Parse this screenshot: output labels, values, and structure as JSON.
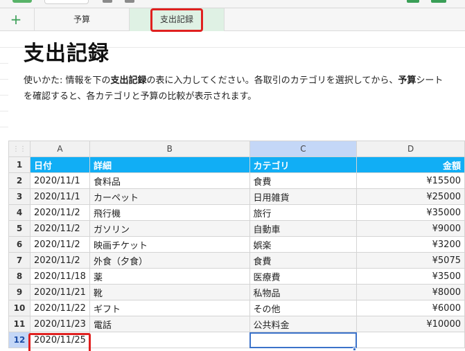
{
  "tabs": [
    {
      "label": "予算"
    },
    {
      "label": "支出記録"
    }
  ],
  "add_tab_label": "+",
  "title": "支出記録",
  "description": {
    "part1": "使いかた: 情報を下の",
    "bold1": "支出記録",
    "part2": "の表に入力してください。各取引のカテゴリを選択してから、",
    "bold2": "予算",
    "part3": "シートを確認すると、各カテゴリと予算の比較が表示されます。"
  },
  "columns": [
    "A",
    "B",
    "C",
    "D"
  ],
  "corner_glyph": "⋮⋮",
  "header_row": {
    "num": "1",
    "cells": [
      "日付",
      "詳細",
      "カテゴリ",
      "金額"
    ]
  },
  "rows": [
    {
      "num": "2",
      "date": "2020/11/1",
      "detail": "食料品",
      "category": "食費",
      "amount": "¥15500"
    },
    {
      "num": "3",
      "date": "2020/11/1",
      "detail": "カーペット",
      "category": "日用雑貨",
      "amount": "¥25000"
    },
    {
      "num": "4",
      "date": "2020/11/2",
      "detail": "飛行機",
      "category": "旅行",
      "amount": "¥35000"
    },
    {
      "num": "5",
      "date": "2020/11/2",
      "detail": "ガソリン",
      "category": "自動車",
      "amount": "¥9000"
    },
    {
      "num": "6",
      "date": "2020/11/2",
      "detail": "映画チケット",
      "category": "娯楽",
      "amount": "¥3200"
    },
    {
      "num": "7",
      "date": "2020/11/2",
      "detail": "外食（夕食）",
      "category": "食費",
      "amount": "¥5075"
    },
    {
      "num": "8",
      "date": "2020/11/18",
      "detail": "薬",
      "category": "医療費",
      "amount": "¥3500"
    },
    {
      "num": "9",
      "date": "2020/11/21",
      "detail": "靴",
      "category": "私物品",
      "amount": "¥8000"
    },
    {
      "num": "10",
      "date": "2020/11/22",
      "detail": "ギフト",
      "category": "その他",
      "amount": "¥6000"
    },
    {
      "num": "11",
      "date": "2020/11/23",
      "detail": "電話",
      "category": "公共料金",
      "amount": "¥10000"
    },
    {
      "num": "12",
      "date": "2020/11/25",
      "detail": "",
      "category": "",
      "amount": ""
    }
  ],
  "colors": {
    "header_fill": "#11aef5",
    "selection": "#c4d7f7",
    "active_tab": "#dff1e4",
    "annotation": "#e0201f"
  }
}
